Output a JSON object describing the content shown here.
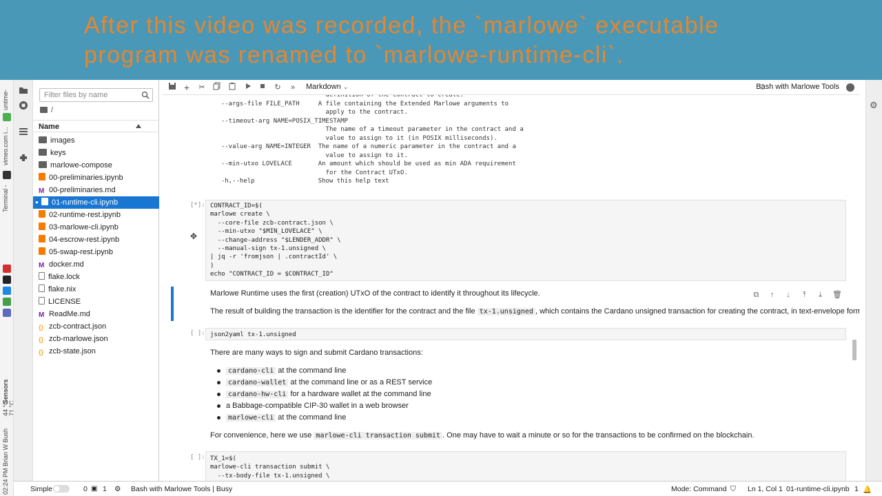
{
  "banner": {
    "text": "After this video was recorded, the `marlowe` executable program was renamed to `marlowe-runtime-cli`."
  },
  "os_side": {
    "labels": [
      "untime-",
      "vimeo.com i...",
      "Terminal -",
      "Sensors",
      "71 °C",
      "44 °C",
      "02:24 PM Brian W Bush"
    ]
  },
  "file_browser": {
    "filter_placeholder": "Filter files by name",
    "breadcrumb": "/",
    "column_name": "Name",
    "items": [
      {
        "name": "images",
        "type": "folder"
      },
      {
        "name": "keys",
        "type": "folder"
      },
      {
        "name": "marlowe-compose",
        "type": "folder"
      },
      {
        "name": "00-preliminaries.ipynb",
        "type": "notebook"
      },
      {
        "name": "00-preliminaries.md",
        "type": "markdown"
      },
      {
        "name": "01-runtime-cli.ipynb",
        "type": "notebook",
        "selected": true
      },
      {
        "name": "02-runtime-rest.ipynb",
        "type": "notebook"
      },
      {
        "name": "03-marlowe-cli.ipynb",
        "type": "notebook"
      },
      {
        "name": "04-escrow-rest.ipynb",
        "type": "notebook"
      },
      {
        "name": "05-swap-rest.ipynb",
        "type": "notebook"
      },
      {
        "name": "docker.md",
        "type": "markdown"
      },
      {
        "name": "flake.lock",
        "type": "file"
      },
      {
        "name": "flake.nix",
        "type": "file"
      },
      {
        "name": "LICENSE",
        "type": "file"
      },
      {
        "name": "ReadMe.md",
        "type": "markdown"
      },
      {
        "name": "zcb-contract.json",
        "type": "json"
      },
      {
        "name": "zcb-marlowe.json",
        "type": "json"
      },
      {
        "name": "zcb-state.json",
        "type": "json"
      }
    ]
  },
  "toolbar": {
    "cell_type": "Markdown",
    "kernel_name": "Bash with Marlowe Tools"
  },
  "notebook": {
    "help_output": [
      "                              definition of the contract to create.",
      "  --args-file FILE_PATH     A file containing the Extended Marlowe arguments to",
      "                              apply to the contract.",
      "  --timeout-arg NAME=POSIX_TIMESTAMP",
      "                              The name of a timeout parameter in the contract and a",
      "                              value to assign to it (in POSIX milliseconds).",
      "  --value-arg NAME=INTEGER  The name of a numeric parameter in the contract and a",
      "                              value to assign to it.",
      "  --min-utxo LOVELACE       An amount which should be used as min ADA requirement",
      "                              for the Contract UTxO.",
      "  -h,--help                 Show this help text"
    ],
    "cell1_prompt": "[*]:",
    "cell1_lines": [
      "CONTRACT_ID=$(",
      "marlowe create \\",
      "  --core-file zcb-contract.json \\",
      "  --min-utxo \"$MIN_LOVELACE\" \\",
      "  --change-address \"$LENDER_ADDR\" \\",
      "  --manual-sign tx-1.unsigned \\",
      "| jq -r 'fromjson | .contractId' \\",
      ")",
      "echo \"CONTRACT_ID = $CONTRACT_ID\""
    ],
    "md1_line1": "Marlowe Runtime uses the first (creation) UTxO of the contract to identify it throughout its lifecycle.",
    "md1_line2_pre": "The result of building the transaction is the identifier for the contract and the file ",
    "md1_line2_code": "tx-1.unsigned",
    "md1_line2_post": ", which contains the Cardano unsigned transaction for creating the contract, in text-envelope format.",
    "cell2_prompt": "[ ]:",
    "cell2_line": "json2yaml tx-1.unsigned",
    "md2_intro": "There are many ways to sign and submit Cardano transactions:",
    "bullets": [
      {
        "code": "cardano-cli",
        "text": " at the command line"
      },
      {
        "code": "cardano-wallet",
        "text": " at the command line or as a REST service"
      },
      {
        "code": "cardano-hw-cli",
        "text": " for a hardware wallet at the command line"
      },
      {
        "code": "",
        "text": "a Babbage-compatible CIP-30 wallet in a web browser"
      },
      {
        "code": "marlowe-cli",
        "text": " at the command line"
      }
    ],
    "md3_pre": "For convenience, here we use ",
    "md3_code": "marlowe-cli transaction submit",
    "md3_post": ". One may have to wait a minute or so for the transactions to be confirmed on the blockchain.",
    "cell3_prompt": "[ ]:",
    "cell3_lines": [
      "TX_1=$(",
      "marlowe-cli transaction submit \\",
      "  --tx-body-file tx-1.unsigned \\"
    ]
  },
  "statusbar": {
    "mode_label": "Simple",
    "count_a": "0",
    "count_b": "1",
    "kernel_status": "Bash with Marlowe Tools | Busy",
    "mode": "Mode: Command",
    "position": "Ln 1, Col 1",
    "filename": "01-runtime-cli.ipynb",
    "notifications": "1"
  }
}
